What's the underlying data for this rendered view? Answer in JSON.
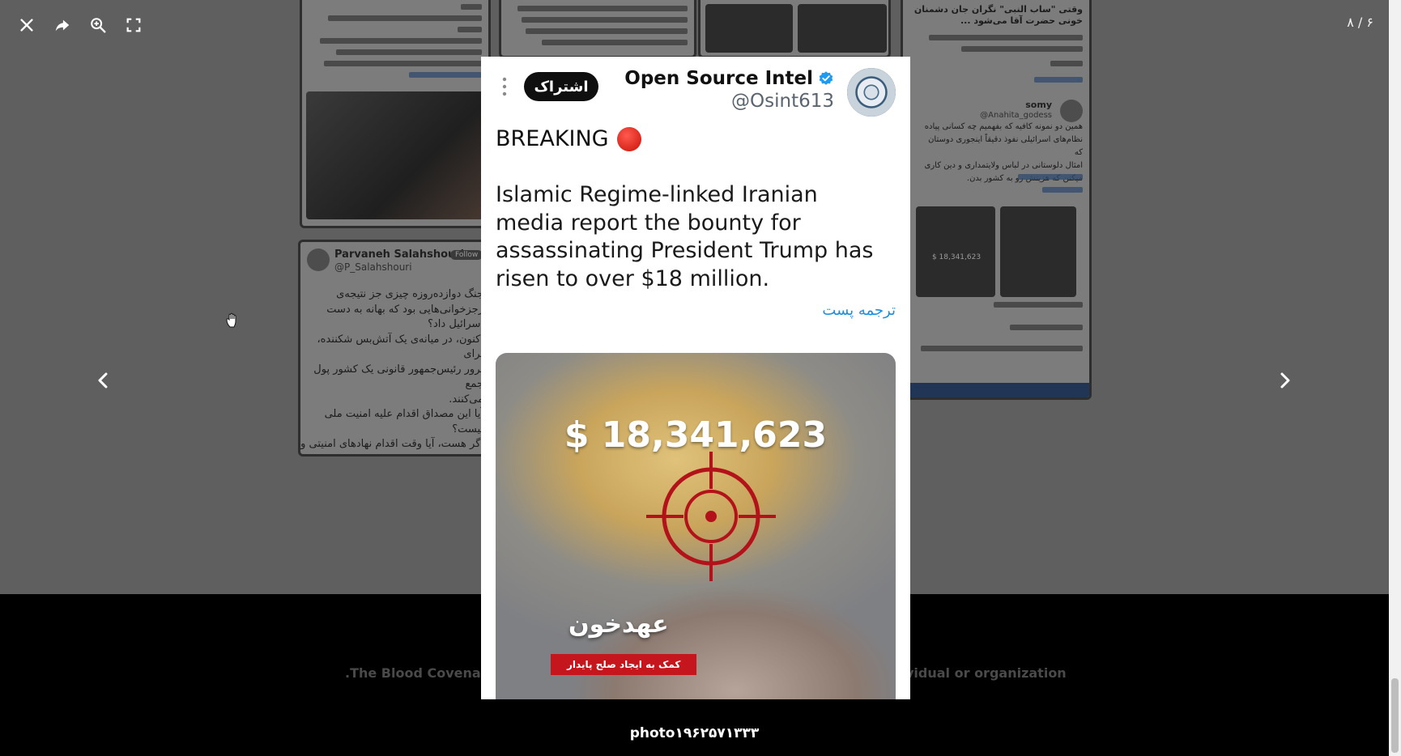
{
  "viewer": {
    "counter": "۸ / ۶",
    "caption": "photo۱۹۶۲۵۷۱۳۳۳"
  },
  "colors": {
    "overlay": "#5e5e5e",
    "footer": "#000000",
    "accent_link": "#1d8fe0",
    "breaking_red": "#d9261c",
    "banner_red": "#c5161d"
  },
  "icons": {
    "close": "close-icon",
    "share": "share-icon",
    "zoom": "zoom-in-icon",
    "fullscreen": "fullscreen-icon",
    "prev": "chevron-left-icon",
    "next": "chevron-right-icon",
    "cursor": "hand-cursor-icon"
  },
  "background": {
    "footer_left": ".The Blood Covenant",
    "footer_right": "vidual or organization",
    "card_left_name": "Parvaneh Salahshouri...",
    "card_left_badge": "Follow",
    "card_left_handle": "@P_Salahshouri",
    "card_left_text": "جنگ دوازده‌روزه چیزی جز نتیجه‌ی\nرجزخوانی‌هایی بود که بهانه به دست\nاسرائیل داد؟\nاکنون، در میانه‌ی یک آتش‌بس شکننده، برای\nترور رئیس‌جمهور قانونی یک کشور پول جمع\nمی‌کنند.\nآیا این مصداق اقدام علیه امنیت ملی\nنیست؟\nاگر هست، آیا وقت اقدام نهادهای امنیتی و\nمدعی‌العموم نرسیده؟\n#نفوذ",
    "card_right_name": "somy",
    "card_right_handle": "@Anahita_godess",
    "card_right_title": "وقتی \"ساب النبی\" نگران جان دشمنان خونی حضرت آقا می‌شود ...",
    "card_right_text": "همین دو نمونه کافیه که بفهمیم چه کسانی پیاده\nنظام‌های اسرائیلی نفوذ دقیقاً اینجوری دوستان که\nامثال دلوستانی در لباس ولایتمداری و دین کاری\nمیکنن که هزینش رو به کشور بدن.",
    "card_right_thumb_value": "$ 18,341,623"
  },
  "tweet": {
    "account_name": "Open Source Intel",
    "handle": "@Osint613",
    "subscribe_label": "اشتراک",
    "breaking_label": "BREAKING",
    "body": "Islamic Regime-linked Iranian media report the bounty for assassinating President Trump has risen to over $18 million.",
    "translate_label": "ترجمه پست",
    "media": {
      "bounty_amount": "$ 18,341,623",
      "covenant_label": "عهدخون",
      "banner_label": "کمک به ایجاد صلح پایدار"
    }
  }
}
